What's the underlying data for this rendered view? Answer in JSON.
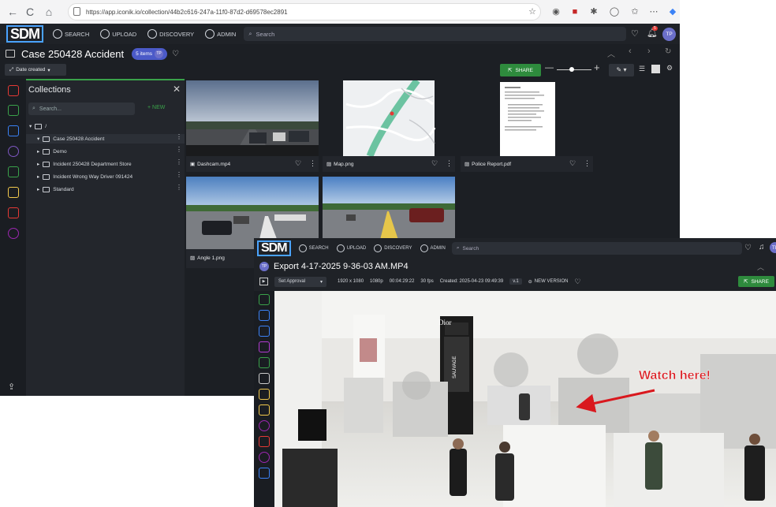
{
  "browser": {
    "url": "https://app.iconik.io/collection/44b2c616-247a-11f0-87d2-d69578ec2891",
    "nav_buttons": [
      "←",
      "C",
      "⌂"
    ]
  },
  "app": {
    "logo": "SDM",
    "nav": [
      "SEARCH",
      "UPLOAD",
      "DISCOVERY",
      "ADMIN"
    ],
    "search_placeholder": "Search",
    "notification_count": "5",
    "user_initials": "TP"
  },
  "collection": {
    "title": "Case 250428 Accident",
    "items_badge": "5 items",
    "sort_label": "Date created",
    "share_label": "SHARE"
  },
  "sidebar": {
    "title": "Collections",
    "search_placeholder": "Search...",
    "new_label": "+ NEW",
    "root": "/",
    "items": [
      {
        "label": "Case 250428 Accident"
      },
      {
        "label": "Demo"
      },
      {
        "label": "Incident 250428 Department Store"
      },
      {
        "label": "Incident Wrong Way Driver 091424"
      },
      {
        "label": "Standard"
      }
    ]
  },
  "assets": [
    {
      "name": "Dashcam.mp4",
      "type": "video"
    },
    {
      "name": "Map.png",
      "type": "image"
    },
    {
      "name": "Police Report.pdf",
      "type": "image"
    },
    {
      "name": "",
      "type": "image"
    },
    {
      "name": "Angle 1.png",
      "type": "image"
    }
  ],
  "detail": {
    "logo": "SDM",
    "nav": [
      "SEARCH",
      "UPLOAD",
      "DISCOVERY",
      "ADMIN"
    ],
    "search_placeholder": "Search",
    "user_initials": "TP",
    "title": "Export 4-17-2025 9-36-03 AM.MP4",
    "approval_label": "Set Approval",
    "resolution": "1920 x 1080",
    "quality": "1080p",
    "duration": "00:04:29:22",
    "fps": "30 fps",
    "created": "Created: 2025-04-23 09:49:39",
    "version": "v.1",
    "new_version_label": "NEW VERSION",
    "share_label": "SHARE",
    "annotation": "Watch here!",
    "store_sign": "Dior",
    "store_sign2": "SAUVAGE"
  },
  "colors": {
    "accent_green": "#2e8b3d",
    "accent_blue": "#4b5ac8",
    "annotation_red": "#d9181e"
  }
}
